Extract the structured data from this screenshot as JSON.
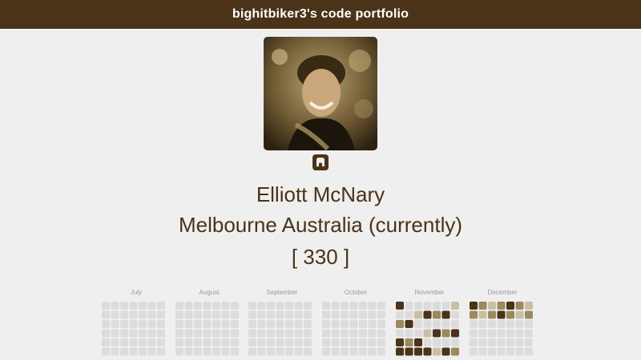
{
  "header": {
    "title": "bighitbiker3's code portfolio"
  },
  "profile": {
    "name": "Elliott McNary",
    "location": "Melbourne Australia (currently)",
    "count": "[ 330 ]",
    "avatar_alt": "profile photo",
    "github_icon": "github-icon"
  },
  "calendar": {
    "months": [
      "July",
      "August",
      "September",
      "October",
      "November",
      "December"
    ],
    "colors": {
      "empty": "#dcdcdc",
      "light": "#c8c0a4",
      "medium": "#9a8a5c",
      "dark": "#4a3318"
    }
  }
}
